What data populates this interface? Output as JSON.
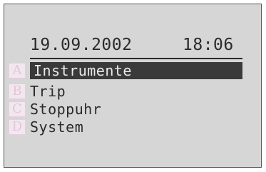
{
  "header": {
    "date": "19.09.2002",
    "time": "18:06"
  },
  "menu": {
    "items": [
      {
        "letter": "A",
        "label": "Instrumente",
        "selected": true
      },
      {
        "letter": "B",
        "label": "Trip",
        "selected": false
      },
      {
        "letter": "C",
        "label": "Stoppuhr",
        "selected": false
      },
      {
        "letter": "D",
        "label": "System",
        "selected": false
      }
    ]
  },
  "colors": {
    "screen_background": "#d6d6d6",
    "text": "#2a2a2a",
    "highlight_background": "#3a3a3a",
    "highlight_text": "#e9e9e9",
    "callout_letter": "#e1c6d8"
  }
}
